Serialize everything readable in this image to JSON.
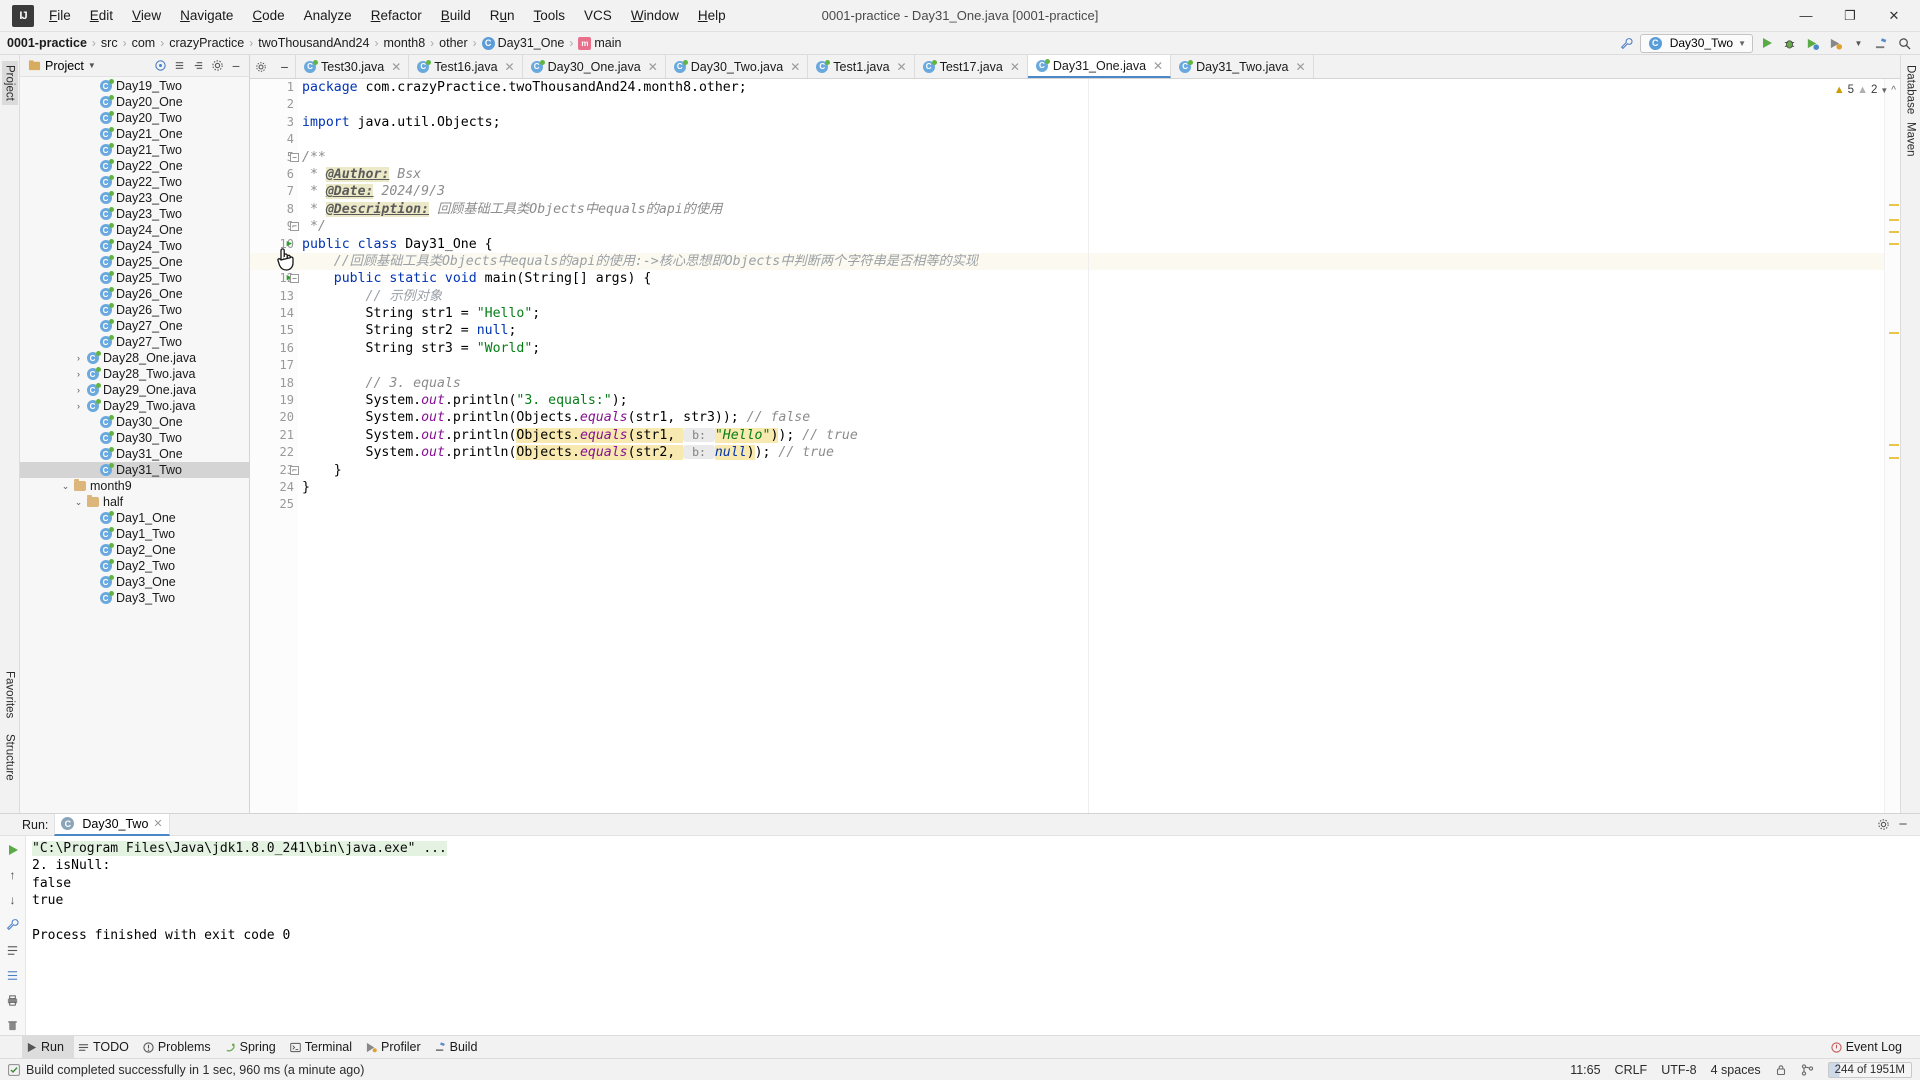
{
  "titlebar": {
    "logo": "IJ",
    "window_title": "0001-practice - Day31_One.java [0001-practice]",
    "menus": [
      "File",
      "Edit",
      "View",
      "Navigate",
      "Code",
      "Analyze",
      "Refactor",
      "Build",
      "Run",
      "Tools",
      "VCS",
      "Window",
      "Help"
    ],
    "minimize": "—",
    "maximize": "❐",
    "close": "✕"
  },
  "navbar": {
    "crumbs": [
      {
        "label": "0001-practice",
        "bold": true,
        "icon": null
      },
      {
        "label": "src",
        "bold": false,
        "icon": null
      },
      {
        "label": "com",
        "bold": false,
        "icon": null
      },
      {
        "label": "crazyPractice",
        "bold": false,
        "icon": null
      },
      {
        "label": "twoThousandAnd24",
        "bold": false,
        "icon": null
      },
      {
        "label": "month8",
        "bold": false,
        "icon": null
      },
      {
        "label": "other",
        "bold": false,
        "icon": null
      },
      {
        "label": "Day31_One",
        "bold": false,
        "icon": "class-icon"
      },
      {
        "label": "main",
        "bold": false,
        "icon": "method-icon"
      }
    ],
    "separator": "›",
    "run_configuration": "Day30_Two",
    "icons": [
      "wrench-icon",
      "run-icon",
      "debug-icon",
      "coverage-icon",
      "profile-icon",
      "build-icon",
      "search-everywhere-icon"
    ]
  },
  "left_strip": {
    "tabs": [
      "Project",
      "Structure",
      "Favorites"
    ],
    "selected": "Project"
  },
  "right_strip": {
    "tabs": [
      "Database",
      "Maven"
    ]
  },
  "project_panel": {
    "title": "Project",
    "header_icons": [
      "target-icon",
      "collapse-icon",
      "expand-icon",
      "settings-icon",
      "hide-icon"
    ],
    "tree": [
      {
        "label": "Day19_Two",
        "indent": 5,
        "icon": "java-class-icon",
        "arrow": "",
        "selected": false
      },
      {
        "label": "Day20_One",
        "indent": 5,
        "icon": "java-class-icon",
        "arrow": "",
        "selected": false
      },
      {
        "label": "Day20_Two",
        "indent": 5,
        "icon": "java-class-icon",
        "arrow": "",
        "selected": false
      },
      {
        "label": "Day21_One",
        "indent": 5,
        "icon": "java-class-icon",
        "arrow": "",
        "selected": false
      },
      {
        "label": "Day21_Two",
        "indent": 5,
        "icon": "java-class-icon",
        "arrow": "",
        "selected": false
      },
      {
        "label": "Day22_One",
        "indent": 5,
        "icon": "java-class-icon",
        "arrow": "",
        "selected": false
      },
      {
        "label": "Day22_Two",
        "indent": 5,
        "icon": "java-class-icon",
        "arrow": "",
        "selected": false
      },
      {
        "label": "Day23_One",
        "indent": 5,
        "icon": "java-class-icon",
        "arrow": "",
        "selected": false
      },
      {
        "label": "Day23_Two",
        "indent": 5,
        "icon": "java-class-icon",
        "arrow": "",
        "selected": false
      },
      {
        "label": "Day24_One",
        "indent": 5,
        "icon": "java-class-icon",
        "arrow": "",
        "selected": false
      },
      {
        "label": "Day24_Two",
        "indent": 5,
        "icon": "java-class-icon",
        "arrow": "",
        "selected": false
      },
      {
        "label": "Day25_One",
        "indent": 5,
        "icon": "java-class-icon",
        "arrow": "",
        "selected": false
      },
      {
        "label": "Day25_Two",
        "indent": 5,
        "icon": "java-class-icon",
        "arrow": "",
        "selected": false
      },
      {
        "label": "Day26_One",
        "indent": 5,
        "icon": "java-class-icon",
        "arrow": "",
        "selected": false
      },
      {
        "label": "Day26_Two",
        "indent": 5,
        "icon": "java-class-icon",
        "arrow": "",
        "selected": false
      },
      {
        "label": "Day27_One",
        "indent": 5,
        "icon": "java-class-icon",
        "arrow": "",
        "selected": false
      },
      {
        "label": "Day27_Two",
        "indent": 5,
        "icon": "java-class-icon",
        "arrow": "",
        "selected": false
      },
      {
        "label": "Day28_One.java",
        "indent": 4,
        "icon": "java-class-icon",
        "arrow": "›",
        "selected": false
      },
      {
        "label": "Day28_Two.java",
        "indent": 4,
        "icon": "java-class-icon",
        "arrow": "›",
        "selected": false
      },
      {
        "label": "Day29_One.java",
        "indent": 4,
        "icon": "java-class-icon",
        "arrow": "›",
        "selected": false
      },
      {
        "label": "Day29_Two.java",
        "indent": 4,
        "icon": "java-class-icon",
        "arrow": "›",
        "selected": false
      },
      {
        "label": "Day30_One",
        "indent": 5,
        "icon": "java-class-icon",
        "arrow": "",
        "selected": false
      },
      {
        "label": "Day30_Two",
        "indent": 5,
        "icon": "java-class-icon",
        "arrow": "",
        "selected": false
      },
      {
        "label": "Day31_One",
        "indent": 5,
        "icon": "java-class-icon",
        "arrow": "",
        "selected": false
      },
      {
        "label": "Day31_Two",
        "indent": 5,
        "icon": "java-class-icon",
        "arrow": "",
        "selected": true
      },
      {
        "label": "month9",
        "indent": 3,
        "icon": "folder-icon",
        "arrow": "⌄",
        "selected": false
      },
      {
        "label": "half",
        "indent": 4,
        "icon": "folder-icon",
        "arrow": "⌄",
        "selected": false
      },
      {
        "label": "Day1_One",
        "indent": 5,
        "icon": "java-class-icon",
        "arrow": "",
        "selected": false
      },
      {
        "label": "Day1_Two",
        "indent": 5,
        "icon": "java-class-icon",
        "arrow": "",
        "selected": false
      },
      {
        "label": "Day2_One",
        "indent": 5,
        "icon": "java-class-icon",
        "arrow": "",
        "selected": false
      },
      {
        "label": "Day2_Two",
        "indent": 5,
        "icon": "java-class-icon",
        "arrow": "",
        "selected": false
      },
      {
        "label": "Day3_One",
        "indent": 5,
        "icon": "java-class-icon",
        "arrow": "",
        "selected": false
      },
      {
        "label": "Day3_Two",
        "indent": 5,
        "icon": "java-class-icon",
        "arrow": "",
        "selected": false
      }
    ]
  },
  "editor": {
    "tabs": [
      {
        "label": "Test30.java",
        "active": false
      },
      {
        "label": "Test16.java",
        "active": false
      },
      {
        "label": "Day30_One.java",
        "active": false
      },
      {
        "label": "Day30_Two.java",
        "active": false
      },
      {
        "label": "Test1.java",
        "active": false
      },
      {
        "label": "Test17.java",
        "active": false
      },
      {
        "label": "Day31_One.java",
        "active": true
      },
      {
        "label": "Day31_Two.java",
        "active": false
      }
    ],
    "close_glyph": "✕",
    "inspection": {
      "warning_count": "5",
      "weak_count": "2",
      "warning_icon": "warning-triangle-icon",
      "weak_icon": "weak-warning-icon"
    },
    "lines": [
      {
        "n": "1",
        "run": false,
        "fold": "",
        "hl": false
      },
      {
        "n": "2",
        "run": false,
        "fold": "",
        "hl": false
      },
      {
        "n": "3",
        "run": false,
        "fold": "",
        "hl": false
      },
      {
        "n": "4",
        "run": false,
        "fold": "",
        "hl": false
      },
      {
        "n": "5",
        "run": false,
        "fold": "−",
        "hl": false
      },
      {
        "n": "6",
        "run": false,
        "fold": "",
        "hl": false
      },
      {
        "n": "7",
        "run": false,
        "fold": "",
        "hl": false
      },
      {
        "n": "8",
        "run": false,
        "fold": "",
        "hl": false
      },
      {
        "n": "9",
        "run": false,
        "fold": "⌐",
        "hl": false
      },
      {
        "n": "10",
        "run": true,
        "fold": "",
        "hl": false
      },
      {
        "n": "11",
        "run": false,
        "fold": "",
        "hl": true
      },
      {
        "n": "12",
        "run": true,
        "fold": "−",
        "hl": false
      },
      {
        "n": "13",
        "run": false,
        "fold": "",
        "hl": false
      },
      {
        "n": "14",
        "run": false,
        "fold": "",
        "hl": false
      },
      {
        "n": "15",
        "run": false,
        "fold": "",
        "hl": false
      },
      {
        "n": "16",
        "run": false,
        "fold": "",
        "hl": false
      },
      {
        "n": "17",
        "run": false,
        "fold": "",
        "hl": false
      },
      {
        "n": "18",
        "run": false,
        "fold": "",
        "hl": false
      },
      {
        "n": "19",
        "run": false,
        "fold": "",
        "hl": false
      },
      {
        "n": "20",
        "run": false,
        "fold": "",
        "hl": false
      },
      {
        "n": "21",
        "run": false,
        "fold": "",
        "hl": false
      },
      {
        "n": "22",
        "run": false,
        "fold": "",
        "hl": false
      },
      {
        "n": "23",
        "run": false,
        "fold": "⌐",
        "hl": false
      },
      {
        "n": "24",
        "run": false,
        "fold": "",
        "hl": false
      },
      {
        "n": "25",
        "run": false,
        "fold": "",
        "hl": false
      }
    ],
    "source_text": [
      "package com.crazyPractice.twoThousandAnd24.month8.other;",
      "",
      "import java.util.Objects;",
      "",
      "/**",
      " * @Author: Bsx",
      " * @Date: 2024/9/3",
      " * @Description: 回顾基础工具类Objects中equals的api的使用",
      " */",
      "public class Day31_One {",
      "    //回顾基础工具类Objects中equals的api的使用:->核心思想即Objects中判断两个字符串是否相等的实现",
      "    public static void main(String[] args) {",
      "        // 示例对象",
      "        String str1 = \"Hello\";",
      "        String str2 = null;",
      "        String str3 = \"World\";",
      "",
      "        // 3. equals",
      "        System.out.println(\"3. equals:\");",
      "        System.out.println(Objects.equals(str1, str3)); // false",
      "        System.out.println(Objects.equals(str1,  b: \"Hello\")); // true",
      "        System.out.println(Objects.equals(str2,  b: null)); // true",
      "    }",
      "}",
      ""
    ],
    "parameter_hints": [
      "b:",
      "b:"
    ]
  },
  "run_panel": {
    "label": "Run:",
    "tab_title": "Day30_Two",
    "tab_close": "✕",
    "side_icons": [
      "rerun-icon",
      "up-arrow-icon",
      "down-arrow-icon",
      "wrench-icon",
      "filter-icon",
      "wrap-icon",
      "print-icon",
      "trash-icon"
    ],
    "header_icons": [
      "settings-gear-icon",
      "hide-icon"
    ],
    "console_lines": [
      {
        "text": "\"C:\\Program Files\\Java\\jdk1.8.0_241\\bin\\java.exe\" ...",
        "style": "cmd"
      },
      {
        "text": "2. isNull:",
        "style": "plain"
      },
      {
        "text": "false",
        "style": "plain"
      },
      {
        "text": "true",
        "style": "plain"
      },
      {
        "text": "",
        "style": "plain"
      },
      {
        "text": "Process finished with exit code 0",
        "style": "plain"
      }
    ]
  },
  "bottom_bar": {
    "items": [
      {
        "label": "Run",
        "icon": "run-icon",
        "selected": true
      },
      {
        "label": "TODO",
        "icon": "todo-icon",
        "selected": false
      },
      {
        "label": "Problems",
        "icon": "problems-icon",
        "selected": false
      },
      {
        "label": "Spring",
        "icon": "spring-icon",
        "selected": false
      },
      {
        "label": "Terminal",
        "icon": "terminal-icon",
        "selected": false
      },
      {
        "label": "Profiler",
        "icon": "profiler-icon",
        "selected": false
      },
      {
        "label": "Build",
        "icon": "build-icon",
        "selected": false
      }
    ],
    "event_log": "Event Log",
    "event_log_icon": "event-log-icon"
  },
  "status_bar": {
    "message": "Build completed successfully in 1 sec, 960 ms (a minute ago)",
    "message_icon": "checkmark-icon",
    "caret_position": "11:65",
    "line_separator": "CRLF",
    "encoding": "UTF-8",
    "indent": "4 spaces",
    "lock_icon": "lock-icon",
    "branch_icon": "branch-icon",
    "memory": "244 of 1951M"
  }
}
